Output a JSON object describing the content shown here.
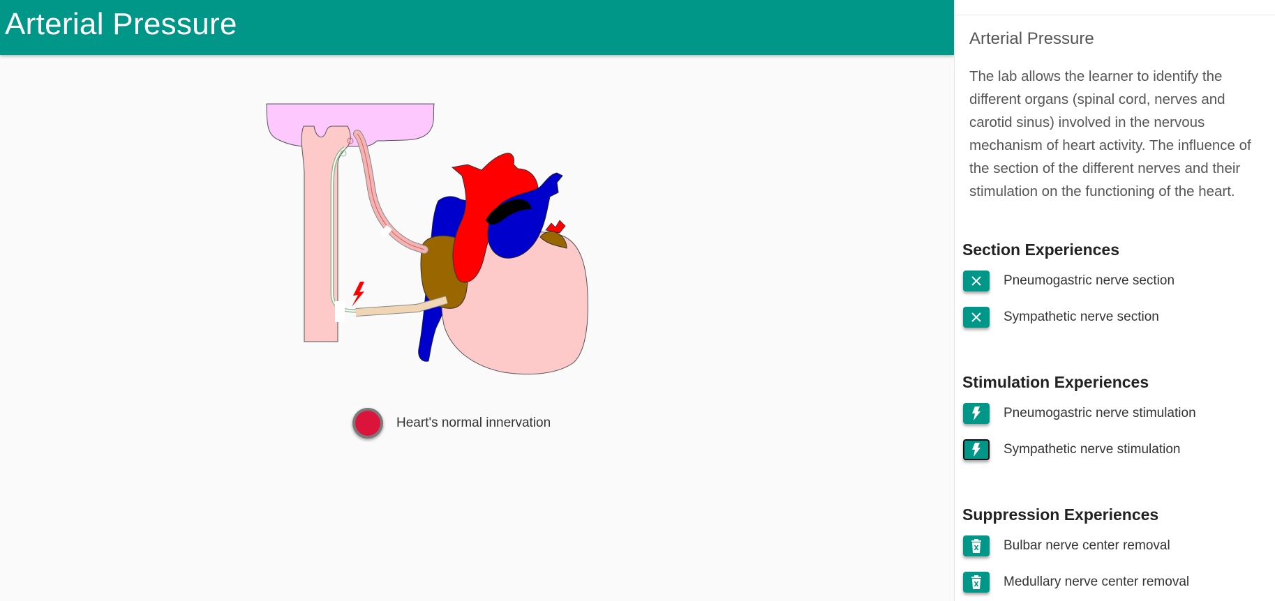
{
  "header": {
    "title": "Arterial Pressure"
  },
  "colors": {
    "primary": "#009688",
    "legend_dot": "#dc143c"
  },
  "legend": {
    "label": "Heart's normal innervation"
  },
  "sidebar": {
    "title": "Arterial Pressure",
    "description": "The lab allows the learner to identify the different organs (spinal cord, nerves and carotid sinus) involved in the nervous mechanism of heart activity. The influence of the section of the different nerves and their stimulation on the functioning of the heart.",
    "sections": [
      {
        "heading": "Section Experiences",
        "icon": "close-icon",
        "items": [
          {
            "label": "Pneumogastric nerve section"
          },
          {
            "label": "Sympathetic nerve section"
          }
        ]
      },
      {
        "heading": "Stimulation Experiences",
        "icon": "lightning-icon",
        "items": [
          {
            "label": "Pneumogastric nerve stimulation"
          },
          {
            "label": "Sympathetic nerve stimulation",
            "focused": true
          }
        ]
      },
      {
        "heading": "Suppression Experiences",
        "icon": "delete-icon",
        "items": [
          {
            "label": "Bulbar nerve center removal"
          },
          {
            "label": "Medullary nerve center removal"
          }
        ]
      }
    ]
  }
}
